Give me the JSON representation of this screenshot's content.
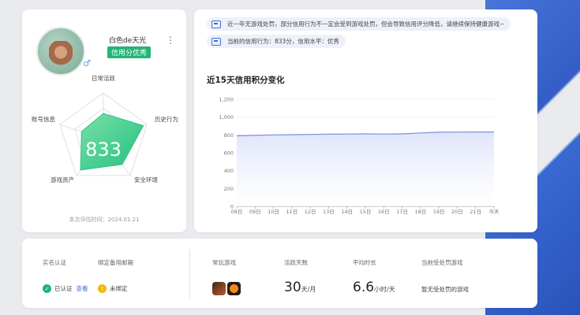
{
  "profile": {
    "username": "白色de天光",
    "credit_badge": "信用分优秀",
    "score": "833",
    "radar_labels": [
      "日常活跃",
      "历史行为",
      "安全环境",
      "游戏资产",
      "账号信息"
    ],
    "radar_values": [
      0.55,
      0.92,
      0.7,
      0.85,
      0.5
    ],
    "eval_date": "本次评估时间：2024.01.21"
  },
  "notices": [
    "近一年无游戏处罚，部分信用行为不一定会受到游戏处罚，但会导致信用评分降低，请继续保持健康游戏~",
    "当前的信用行为：833分，信用水平：优秀"
  ],
  "trend": {
    "title": "近15天信用积分变化"
  },
  "chart_data": {
    "type": "area",
    "title": "近15天信用积分变化",
    "x": [
      "08日",
      "09日",
      "10日",
      "11日",
      "12日",
      "13日",
      "14日",
      "15日",
      "16日",
      "17日",
      "18日",
      "19日",
      "20日",
      "21日",
      "今天"
    ],
    "series": [
      {
        "values": [
          790,
          795,
          800,
          803,
          806,
          808,
          810,
          812,
          810,
          812,
          822,
          830,
          832,
          833,
          833
        ]
      }
    ],
    "yticks": [
      "0",
      "200",
      "400",
      "600",
      "800",
      "1,000",
      "1,200"
    ],
    "ylim": [
      0,
      1200
    ],
    "grid": true,
    "colors": {
      "line": "#7b8fe0",
      "fill": "#dfe5fb"
    }
  },
  "bottom": {
    "labels": [
      "实名认证",
      "绑定备用邮箱",
      "常玩游戏",
      "活跃天数",
      "平均时长",
      "当前受处罚游戏"
    ],
    "verified": "已认证",
    "view": "查看",
    "unbound": "未绑定",
    "days_num": "30",
    "days_unit": "天/月",
    "hours_num": "6.6",
    "hours_unit": "小时/天",
    "no_punish": "暂无受处罚的游戏"
  },
  "colors": {
    "accent": "#3f6fd8",
    "green": "#21b573",
    "warn": "#f5b800"
  }
}
